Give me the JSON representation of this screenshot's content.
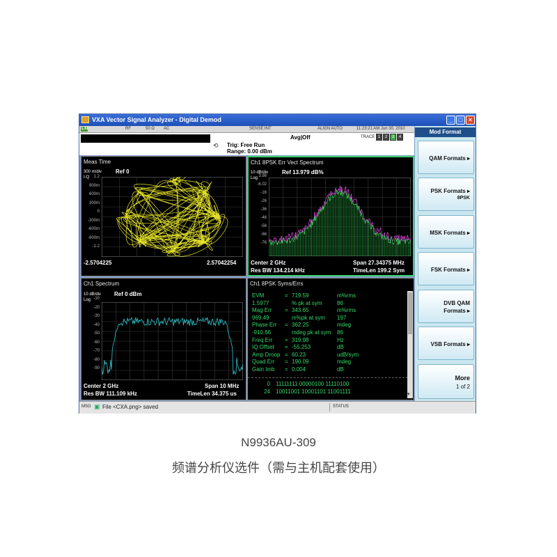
{
  "window": {
    "title": "VXA Vector Signal Analyzer - Digital Demod",
    "min": "_",
    "max": "□",
    "close": "×"
  },
  "status": {
    "lxi": "LXI",
    "rf": "RF",
    "imp": "50 Ω",
    "ac": "AC",
    "sense": "SENSE:INT",
    "align": "ALIGN AUTO",
    "time": "11:23:21 AM Jun 30, 2010",
    "trace_label": "TRACE",
    "traces": [
      "1",
      "2",
      "3",
      "4"
    ]
  },
  "header": {
    "avg": "Avg|Off",
    "trig": "Trig: Free Run",
    "range": "Range: 0.00 dBm"
  },
  "meas_time": {
    "title": "Meas Time",
    "scale": "300 m/div",
    "ref": "Ref 0",
    "mode": "I-Q",
    "ticks": [
      "1.2",
      "900m",
      "600m",
      "300m",
      "0",
      "-300m",
      "-600m",
      "-900m",
      "-1.2"
    ],
    "x_left": "-2.5704225",
    "x_right": "2.57042254",
    "color": "#f0ee2a"
  },
  "err_spectrum": {
    "title": "Ch1 8PSK Err Vect Spectrum",
    "scale": "10 dB/div",
    "ref": "Ref 13.979 dB%",
    "mode": "Log",
    "ticks": [
      "3.98",
      "-6.02",
      "-16",
      "-26",
      "-36",
      "-46",
      "-56",
      "-66",
      "-76"
    ],
    "center": "Center 2 GHz",
    "span": "Span 27.34375 MHz",
    "resbw": "Res BW 134.214 kHz",
    "timelen": "TimeLen 199.2  Sym"
  },
  "spectrum": {
    "title": "Ch1 Spectrum",
    "scale": "10 dB/div",
    "ref": "Ref 0 dBm",
    "mode": "Log",
    "ticks": [
      "-10",
      "-20",
      "-30",
      "-40",
      "-50",
      "-60",
      "-70",
      "-80",
      "-90"
    ],
    "center": "Center 2 GHz",
    "span": "Span 10 MHz",
    "resbw": "Res BW 111.109 kHz",
    "timelen": "TimeLen 34.375 us"
  },
  "syms": {
    "title": "Ch1 8PSK Syms/Errs",
    "rows": [
      {
        "label": "EVM",
        "eq": "=",
        "value": "719.59",
        "unit": "m%rms"
      },
      {
        "label": "1.5977",
        "eq": "",
        "value": "% pk  at   sym",
        "unit": "86"
      },
      {
        "label": "Mag Err",
        "eq": "=",
        "value": "343.65",
        "unit": "m%rms"
      },
      {
        "label": "969.49",
        "eq": "",
        "value": "m%pk  at   sym",
        "unit": "197"
      },
      {
        "label": "Phase Err",
        "eq": "=",
        "value": "362.25",
        "unit": "mdeg"
      },
      {
        "label": "-910.66",
        "eq": "",
        "value": "mdeg pk  at   sym",
        "unit": "86"
      },
      {
        "label": "Freq Err",
        "eq": "=",
        "value": "319.98",
        "unit": "Hz"
      },
      {
        "label": "IQ Offset",
        "eq": "=",
        "value": "-55.253",
        "unit": "dB"
      },
      {
        "label": "Amp Droop",
        "eq": "=",
        "value": "60.23",
        "unit": "udB/sym"
      },
      {
        "label": "Quad Err",
        "eq": "=",
        "value": "190.09",
        "unit": "mdeg"
      },
      {
        "label": "Gain Imb",
        "eq": "=",
        "value": "0.004",
        "unit": "dB"
      }
    ],
    "bits": [
      {
        "idx": "0",
        "b": "11111111  00000100  11110100"
      },
      {
        "idx": "24",
        "b": "10011001  10001101  11001111"
      }
    ]
  },
  "sidebar": {
    "title": "Mod Format",
    "buttons": [
      {
        "label": "QAM Formats",
        "sub": ""
      },
      {
        "label": "PSK Formats",
        "sub": "8PSK"
      },
      {
        "label": "MSK Formats",
        "sub": ""
      },
      {
        "label": "FSK Formats",
        "sub": ""
      },
      {
        "label": "DVB QAM",
        "label2": "Formats",
        "sub": ""
      },
      {
        "label": "VSB Formats",
        "sub": ""
      }
    ],
    "more": "More",
    "more_sub": "1 of 2"
  },
  "msgbar": {
    "msg": "MSG",
    "text": "File <CXA.png> saved",
    "status": "STATUS"
  },
  "caption": {
    "line1": "N9936AU-309",
    "line2": "频谱分析仪选件（需与主机配套使用）"
  }
}
